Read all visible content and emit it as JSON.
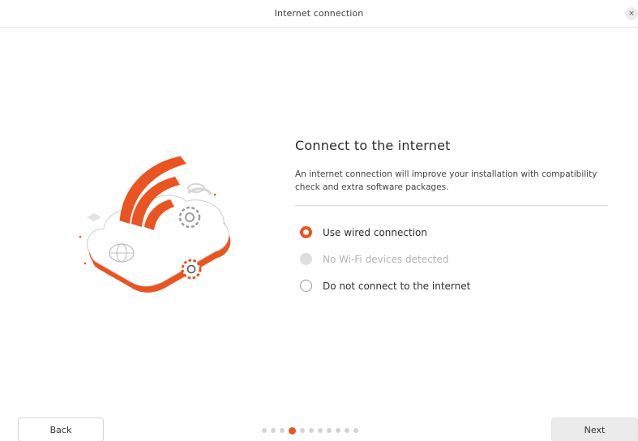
{
  "window": {
    "title": "Internet connection",
    "close_glyph": "×"
  },
  "page": {
    "heading": "Connect to the internet",
    "description": "An internet connection will improve your installation with compatibility check and extra software packages."
  },
  "options": [
    {
      "label": "Use wired connection",
      "state": "selected"
    },
    {
      "label": "No Wi-Fi devices detected",
      "state": "disabled"
    },
    {
      "label": "Do not connect to the internet",
      "state": "unselected"
    }
  ],
  "footer": {
    "back_label": "Back",
    "next_label": "Next",
    "progress": {
      "total_steps": 11,
      "current_step": 4
    }
  },
  "illustration": {
    "icon": "cloud-wifi-gears-illustration"
  },
  "colors": {
    "accent": "#E95420",
    "disabled": "#DEDEDE"
  }
}
